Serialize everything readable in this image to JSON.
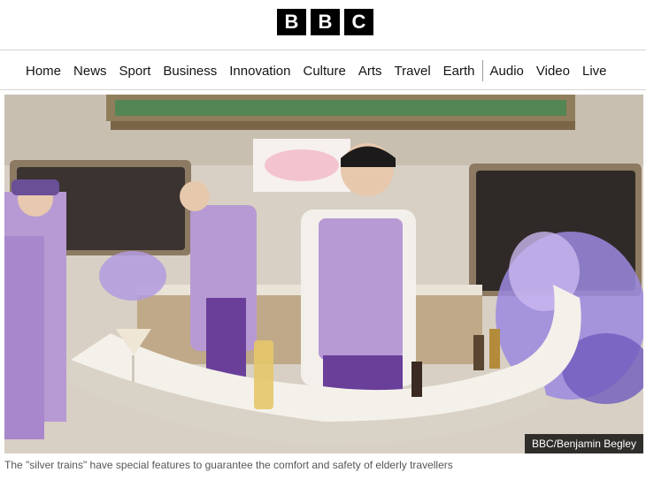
{
  "brand": {
    "logo_letters": [
      "B",
      "B",
      "C"
    ]
  },
  "nav": {
    "items": [
      "Home",
      "News",
      "Sport",
      "Business",
      "Innovation",
      "Culture",
      "Arts",
      "Travel",
      "Earth"
    ],
    "secondary_items": [
      "Audio",
      "Video",
      "Live"
    ]
  },
  "hero": {
    "image_icon": "photo-train-bar",
    "credit": "BBC/Benjamin Begley",
    "caption": "The \"silver trains\" have special features to guarantee the comfort and safety of elderly travellers"
  },
  "colors": {
    "logo_bg": "#000000",
    "divider": "#d5d5d5",
    "uniform_purple": "#b79ad4",
    "counter": "#f4f1ea",
    "flowers": "#9b8ae0"
  }
}
